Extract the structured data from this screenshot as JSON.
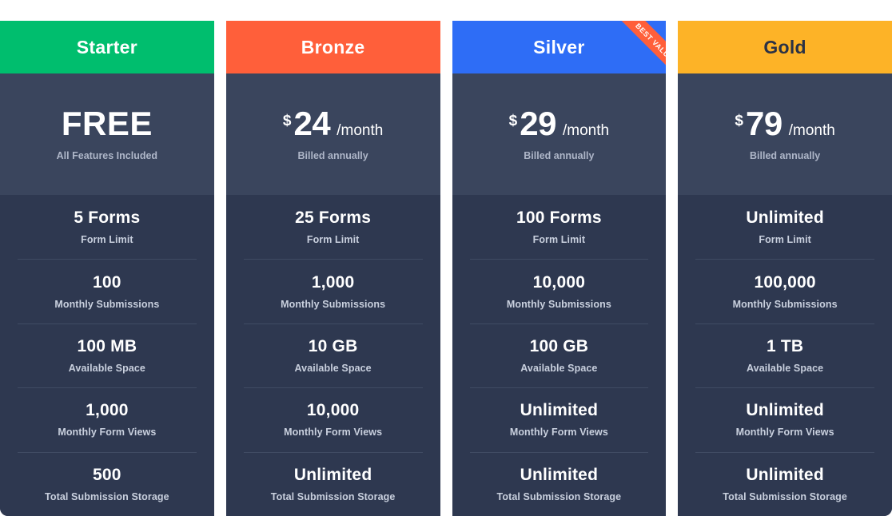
{
  "theme": {
    "page_background": "#FFFFFF",
    "card_body": "#2E3850",
    "price_panel": "#3A455D",
    "divider": "#404B63",
    "value_text": "#FFFFFF",
    "label_text": "#C9D0DE",
    "note_text": "#AEB6C8"
  },
  "ribbon": {
    "label": "BEST VALUE",
    "color": "#FF5F3A",
    "on_plan": "Silver"
  },
  "feature_labels": [
    "Form Limit",
    "Monthly Submissions",
    "Available Space",
    "Monthly Form Views",
    "Total Submission Storage"
  ],
  "plans": [
    {
      "name": "Starter",
      "accent": "#00BE6E",
      "name_color": "#FFFFFF",
      "price_currency": "",
      "price_amount": "FREE",
      "price_period": "",
      "price_note": "All Features Included",
      "is_free": true,
      "has_ribbon": false,
      "features": [
        {
          "value": "5 Forms",
          "label": "Form Limit"
        },
        {
          "value": "100",
          "label": "Monthly Submissions"
        },
        {
          "value": "100 MB",
          "label": "Available Space"
        },
        {
          "value": "1,000",
          "label": "Monthly Form Views"
        },
        {
          "value": "500",
          "label": "Total Submission Storage"
        }
      ]
    },
    {
      "name": "Bronze",
      "accent": "#FF5F3A",
      "name_color": "#FFFFFF",
      "price_currency": "$",
      "price_amount": "24",
      "price_period": "/month",
      "price_note": "Billed annually",
      "is_free": false,
      "has_ribbon": false,
      "features": [
        {
          "value": "25 Forms",
          "label": "Form Limit"
        },
        {
          "value": "1,000",
          "label": "Monthly Submissions"
        },
        {
          "value": "10 GB",
          "label": "Available Space"
        },
        {
          "value": "10,000",
          "label": "Monthly Form Views"
        },
        {
          "value": "Unlimited",
          "label": "Total Submission Storage"
        }
      ]
    },
    {
      "name": "Silver",
      "accent": "#2E6DF6",
      "name_color": "#FFFFFF",
      "price_currency": "$",
      "price_amount": "29",
      "price_period": "/month",
      "price_note": "Billed annually",
      "is_free": false,
      "has_ribbon": true,
      "features": [
        {
          "value": "100 Forms",
          "label": "Form Limit"
        },
        {
          "value": "10,000",
          "label": "Monthly Submissions"
        },
        {
          "value": "100 GB",
          "label": "Available Space"
        },
        {
          "value": "Unlimited",
          "label": "Monthly Form Views"
        },
        {
          "value": "Unlimited",
          "label": "Total Submission Storage"
        }
      ]
    },
    {
      "name": "Gold",
      "accent": "#FDB327",
      "name_color": "#2B3245",
      "price_currency": "$",
      "price_amount": "79",
      "price_period": "/month",
      "price_note": "Billed annually",
      "is_free": false,
      "has_ribbon": false,
      "features": [
        {
          "value": "Unlimited",
          "label": "Form Limit"
        },
        {
          "value": "100,000",
          "label": "Monthly Submissions"
        },
        {
          "value": "1 TB",
          "label": "Available Space"
        },
        {
          "value": "Unlimited",
          "label": "Monthly Form Views"
        },
        {
          "value": "Unlimited",
          "label": "Total Submission Storage"
        }
      ]
    }
  ]
}
